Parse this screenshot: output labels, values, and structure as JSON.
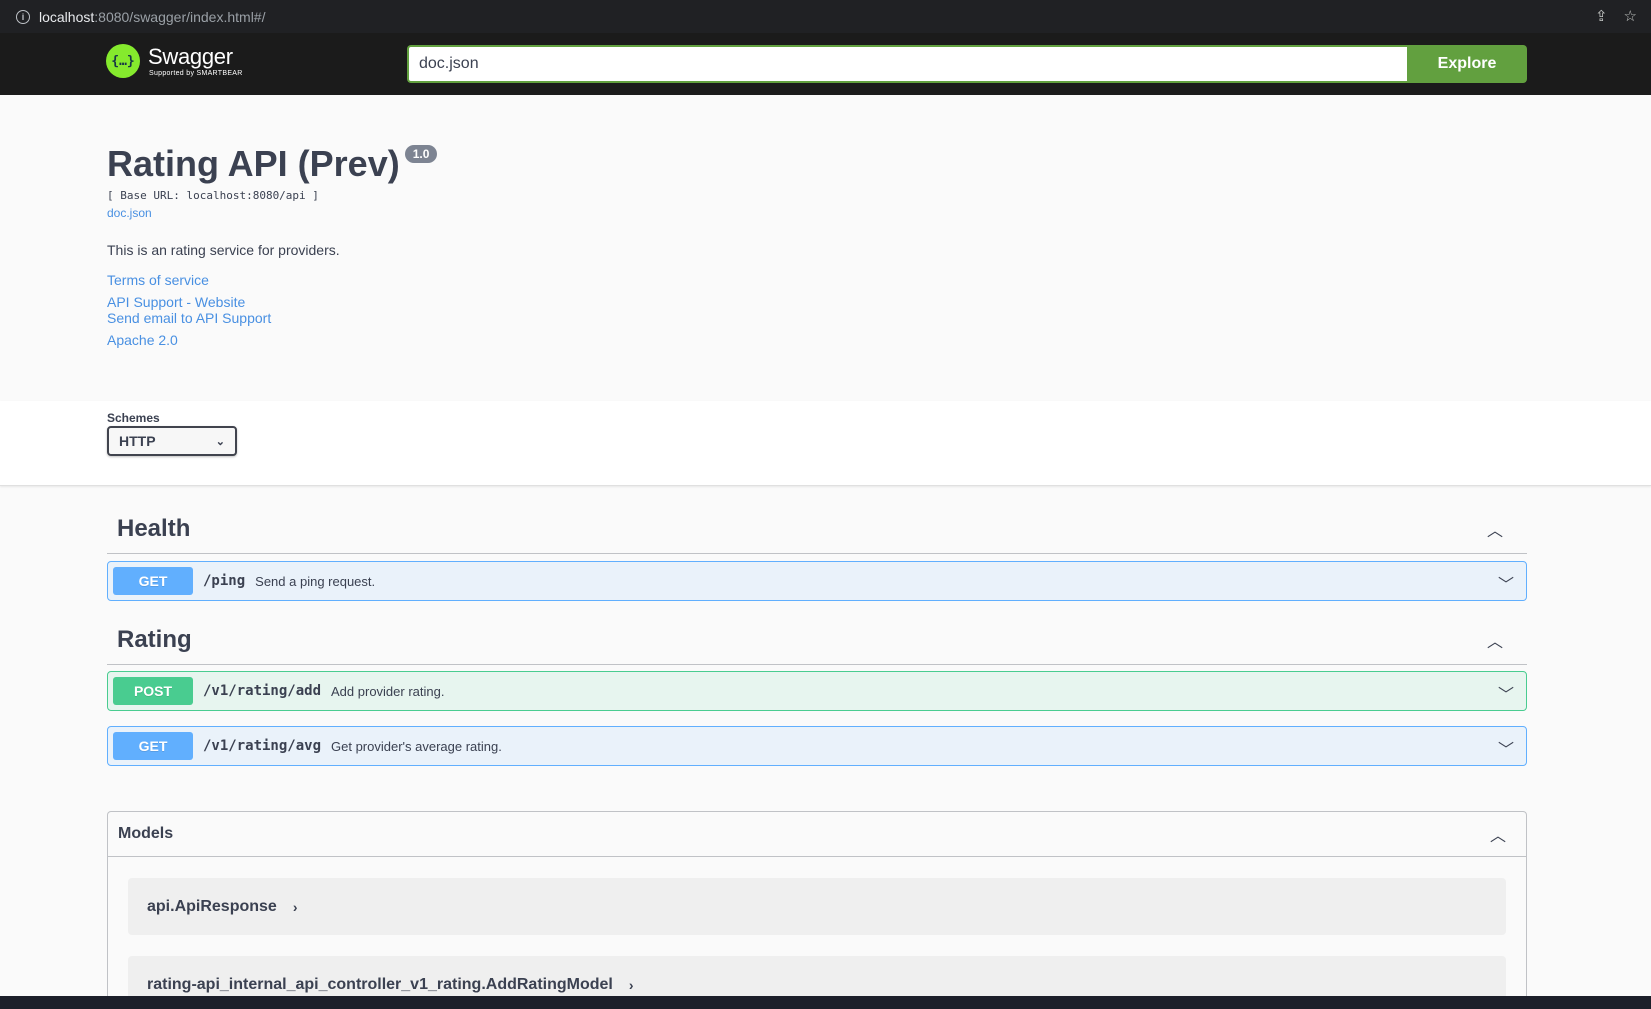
{
  "browser": {
    "url_host": "localhost",
    "url_rest": ":8080/swagger/index.html#/"
  },
  "topbar": {
    "logo_name": "Swagger",
    "logo_sub": "Supported by SMARTBEAR",
    "search_value": "doc.json",
    "explore_label": "Explore",
    "accent": "#62a03f"
  },
  "info": {
    "title": "Rating API (Prev)",
    "version": "1.0",
    "base_url": "[ Base URL: localhost:8080/api ]",
    "doc_link": "doc.json",
    "description": "This is an rating service for providers.",
    "links": [
      "Terms of service",
      "API Support - Website",
      "Send email to API Support",
      "Apache 2.0"
    ]
  },
  "schemes": {
    "label": "Schemes",
    "selected": "HTTP"
  },
  "tags": [
    {
      "name": "Health",
      "operations": [
        {
          "method": "GET",
          "path": "/ping",
          "summary": "Send a ping request."
        }
      ]
    },
    {
      "name": "Rating",
      "operations": [
        {
          "method": "POST",
          "path": "/v1/rating/add",
          "summary": "Add provider rating."
        },
        {
          "method": "GET",
          "path": "/v1/rating/avg",
          "summary": "Get provider's average rating."
        }
      ]
    }
  ],
  "models": {
    "title": "Models",
    "items": [
      "api.ApiResponse",
      "rating-api_internal_api_controller_v1_rating.AddRatingModel"
    ]
  },
  "colors": {
    "get": "#61affe",
    "post": "#49cc90",
    "link": "#4990e2"
  }
}
